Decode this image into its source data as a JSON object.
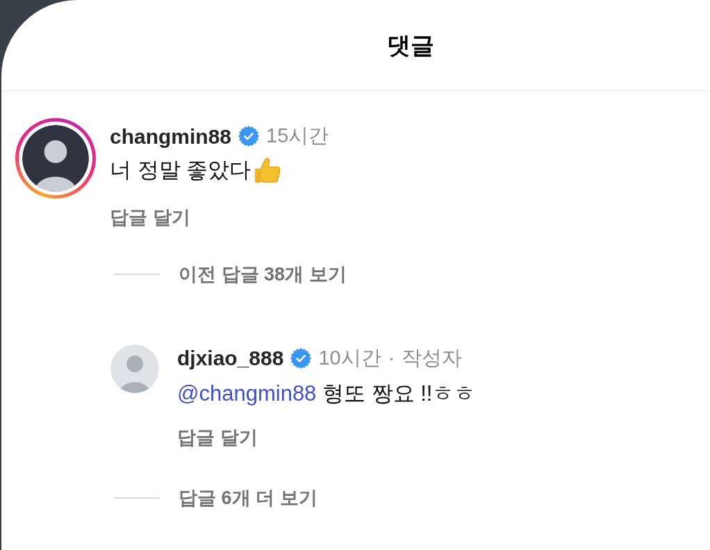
{
  "header": {
    "title": "댓글"
  },
  "comment": {
    "username": "changmin88",
    "verified": true,
    "story_ring": true,
    "time": "15시간",
    "text": "너 정말 좋았다",
    "thumbs_up_emoji": true,
    "reply_action": "답글 달기"
  },
  "previous_replies_link": "이전 답글 38개 보기",
  "replies": [
    {
      "username": "djxiao_888",
      "verified": true,
      "story_ring": false,
      "time": "10시간",
      "separator": "·",
      "author_label": "작성자",
      "mention": "@changmin88",
      "text": "형또 짱요 !!ㅎㅎ",
      "reply_action": "답글 달기"
    }
  ],
  "more_replies_link": "답글 6개 더 보기"
}
